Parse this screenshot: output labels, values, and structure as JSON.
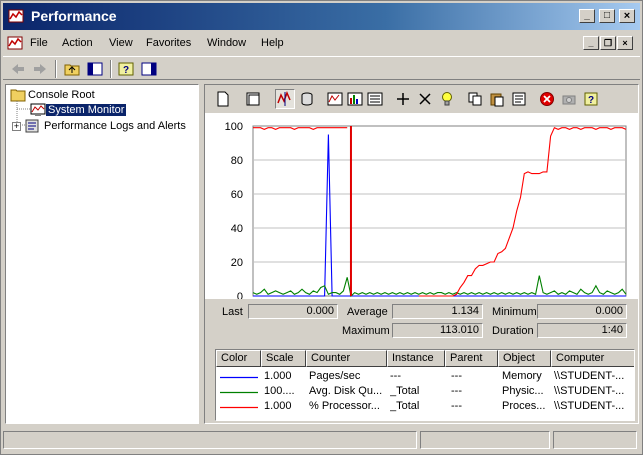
{
  "window": {
    "title": "Performance"
  },
  "menu": [
    "File",
    "Action",
    "View",
    "Favorites",
    "Window",
    "Help"
  ],
  "tree": {
    "items": [
      {
        "label": "Console Root"
      },
      {
        "label": "System Monitor"
      },
      {
        "label": "Performance Logs and Alerts"
      }
    ]
  },
  "stats": {
    "last_label": "Last",
    "last_value": "0.000",
    "average_label": "Average",
    "average_value": "1.134",
    "minimum_label": "Minimum",
    "minimum_value": "0.000",
    "maximum_label": "Maximum",
    "maximum_value": "113.010",
    "duration_label": "Duration",
    "duration_value": "1:40"
  },
  "legend": {
    "headers": [
      "Color",
      "Scale",
      "Counter",
      "Instance",
      "Parent",
      "Object",
      "Computer"
    ],
    "rows": [
      {
        "color": "#0000ff",
        "scale": "1.000",
        "counter": "Pages/sec",
        "instance": "---",
        "parent": "---",
        "object": "Memory",
        "computer": "\\\\STUDENT-..."
      },
      {
        "color": "#008000",
        "scale": "100....",
        "counter": "Avg. Disk Qu...",
        "instance": "_Total",
        "parent": "---",
        "object": "Physic...",
        "computer": "\\\\STUDENT-..."
      },
      {
        "color": "#ff0000",
        "scale": "1.000",
        "counter": "% Processor...",
        "instance": "_Total",
        "parent": "---",
        "object": "Proces...",
        "computer": "\\\\STUDENT-..."
      }
    ]
  },
  "chart_data": {
    "type": "line",
    "ylim": [
      0,
      100
    ],
    "yticks": [
      "100",
      "80",
      "60",
      "40",
      "20",
      "0"
    ],
    "grid": true,
    "current_position": 26,
    "series": [
      {
        "name": "Pages/sec",
        "color": "#0000ff",
        "values": [
          0,
          0,
          0,
          0,
          0,
          0,
          0,
          0,
          0,
          0,
          0,
          0,
          0,
          0,
          0,
          0,
          0,
          0,
          0,
          0,
          95,
          0,
          0,
          0,
          0,
          0,
          0,
          0,
          0,
          0,
          0,
          0,
          0,
          0,
          0,
          0,
          0,
          0,
          0,
          0,
          0,
          0,
          0,
          0,
          0,
          0,
          0,
          0,
          0,
          0,
          0,
          0,
          0,
          0,
          0,
          0,
          0,
          0,
          0,
          0,
          0,
          0,
          0,
          0,
          0,
          0,
          0,
          0,
          0,
          0,
          0,
          0,
          0,
          0,
          0,
          0,
          0,
          0,
          0,
          0,
          0,
          0,
          0,
          0,
          0,
          0,
          0,
          0,
          0,
          0,
          0,
          0,
          0,
          0,
          0,
          0,
          0,
          0,
          0,
          0
        ]
      },
      {
        "name": "Avg. Disk Queue Length",
        "color": "#008000",
        "values": [
          2,
          1,
          2,
          4,
          1,
          2,
          3,
          2,
          1,
          2,
          3,
          1,
          2,
          4,
          2,
          1,
          3,
          2,
          5,
          6,
          1,
          2,
          2,
          1,
          3,
          11,
          0,
          2,
          1,
          2,
          1,
          2,
          1,
          2,
          1,
          2,
          1,
          2,
          1,
          2,
          1,
          2,
          1,
          2,
          1,
          2,
          1,
          2,
          1,
          2,
          2,
          1,
          2,
          1,
          2,
          1,
          2,
          1,
          2,
          1,
          2,
          1,
          2,
          1,
          2,
          1,
          2,
          1,
          2,
          1,
          2,
          1,
          2,
          1,
          2,
          1,
          12,
          2,
          1,
          2,
          3,
          1,
          2,
          1,
          3,
          2,
          1,
          4,
          2,
          1,
          2,
          6,
          2,
          1,
          3,
          2,
          1,
          2,
          4,
          1
        ]
      },
      {
        "name": "% Processor Time",
        "color": "#ff0000",
        "values": [
          99,
          99,
          99,
          98,
          99,
          99,
          98,
          99,
          99,
          99,
          99,
          98,
          99,
          99,
          99,
          99,
          98,
          99,
          99,
          99,
          99,
          99,
          99,
          99,
          99,
          99,
          null,
          null,
          null,
          null,
          null,
          null,
          null,
          null,
          null,
          null,
          null,
          null,
          null,
          null,
          null,
          null,
          null,
          null,
          0,
          0,
          0,
          0,
          0,
          0,
          0,
          0,
          0,
          0,
          1,
          5,
          8,
          12,
          12,
          16,
          18,
          18,
          19,
          20,
          20,
          25,
          26,
          28,
          34,
          40,
          50,
          58,
          72,
          73,
          72,
          72,
          72,
          73,
          73,
          94,
          99,
          98,
          99,
          99,
          98,
          99,
          99,
          98,
          99,
          99,
          99,
          98,
          99,
          99,
          99,
          98,
          99,
          99,
          99,
          98
        ]
      }
    ]
  }
}
